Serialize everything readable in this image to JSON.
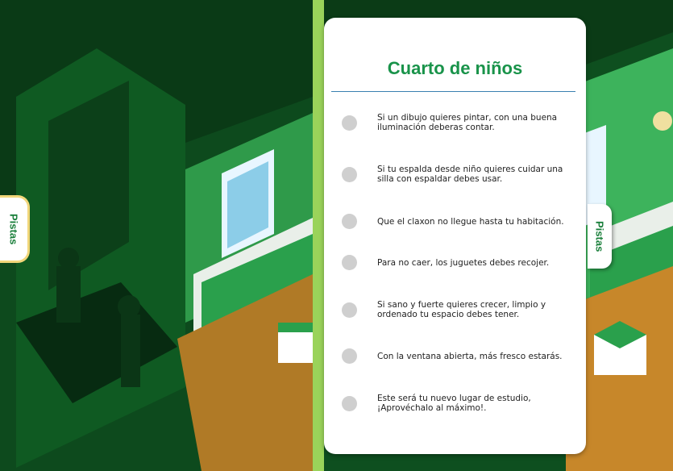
{
  "panel": {
    "title": "Cuarto de niños",
    "clues": [
      {
        "text": "Si un dibujo quieres pintar, con una buena iluminación deberas contar."
      },
      {
        "text": "Si tu espalda desde niño quieres cuidar una silla con espaldar debes usar."
      },
      {
        "text": "Que el claxon no llegue hasta tu habitación."
      },
      {
        "text": "Para no caer, los juguetes debes recojer."
      },
      {
        "text": "Si sano y fuerte quieres crecer, limpio y ordenado tu espacio debes tener."
      },
      {
        "text": "Con la ventana abierta, más fresco estarás."
      },
      {
        "text": "Este será tu nuevo lugar de estudio, ¡Aprovéchalo al máximo!."
      }
    ]
  },
  "tabs": {
    "left_label": "Pistas",
    "right_label": "Pistas"
  },
  "colors": {
    "accent_green": "#19934a",
    "divider_green": "#9ad35a",
    "wall_green": "#3db35c",
    "floor_wood": "#c7872a",
    "dot_gray": "#cfcfcf"
  },
  "icons": [
    "lamp-icon",
    "window-icon",
    "bed-icon",
    "stool-icon"
  ]
}
